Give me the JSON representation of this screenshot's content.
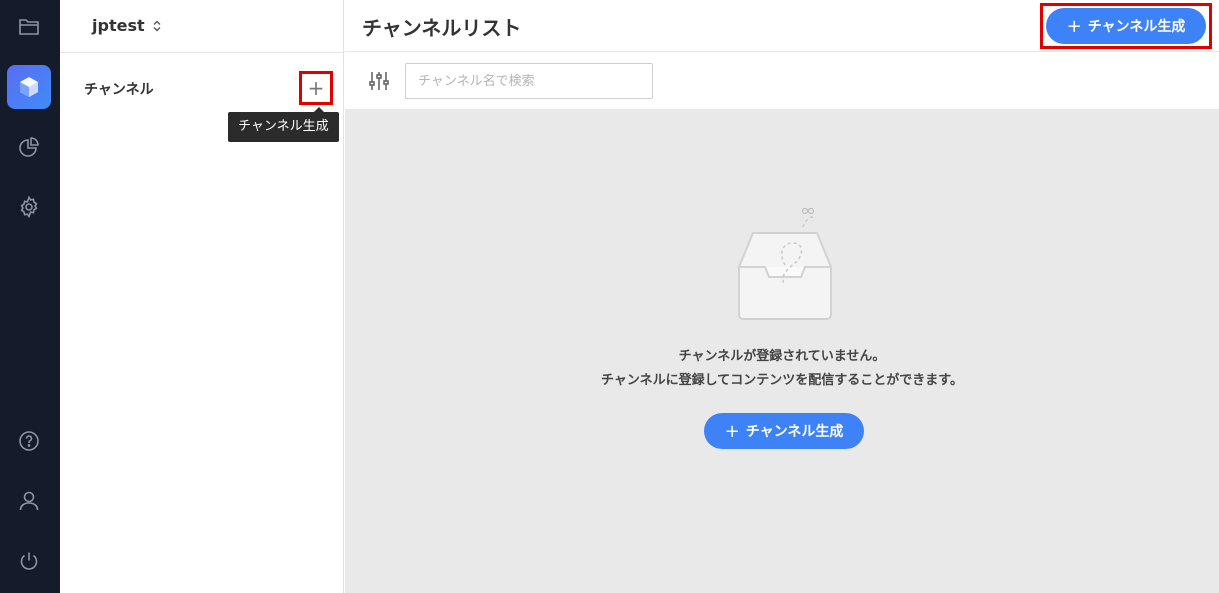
{
  "rail": {
    "items": [
      "folder-icon",
      "box-icon",
      "pie-chart-icon",
      "gear-icon"
    ],
    "bottom": [
      "help-icon",
      "user-icon",
      "power-icon"
    ],
    "active_color": "#4f7cf6"
  },
  "sidebar": {
    "workspace": "jptest",
    "section_label": "チャンネル",
    "add_tooltip": "チャンネル生成"
  },
  "header": {
    "title": "チャンネルリスト",
    "create_label": "チャンネル生成"
  },
  "toolbar": {
    "search_placeholder": "チャンネル名で検索"
  },
  "empty": {
    "line1": "チャンネルが登録されていません。",
    "line2": "チャンネルに登録してコンテンツを配信することができます。",
    "create_label": "チャンネル生成"
  },
  "colors": {
    "primary": "#3e82f7",
    "highlight": "#e00000",
    "rail_bg": "#141b2b"
  }
}
